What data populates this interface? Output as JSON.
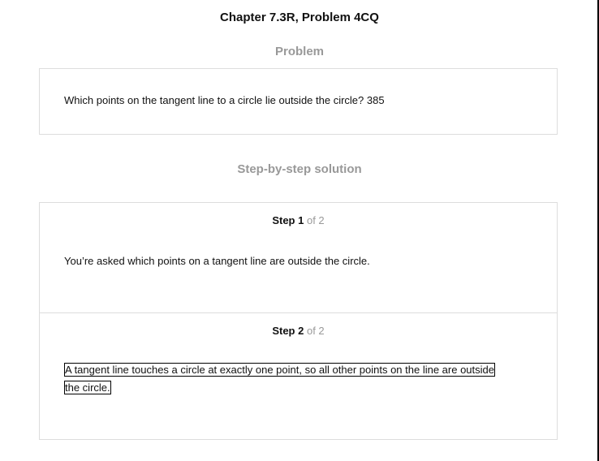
{
  "title": "Chapter 7.3R, Problem 4CQ",
  "problem_heading": "Problem",
  "problem_text": "Which points on the tangent line to a circle lie outside the circle? 385",
  "solution_heading": "Step-by-step solution",
  "steps": [
    {
      "label": "Step 1",
      "of": "of 2",
      "text": "You’re asked which points on a tangent line are outside the circle."
    },
    {
      "label": "Step 2",
      "of": "of 2",
      "text": "A tangent line touches a circle at exactly one point, so all other points on the line are outside the circle."
    }
  ]
}
